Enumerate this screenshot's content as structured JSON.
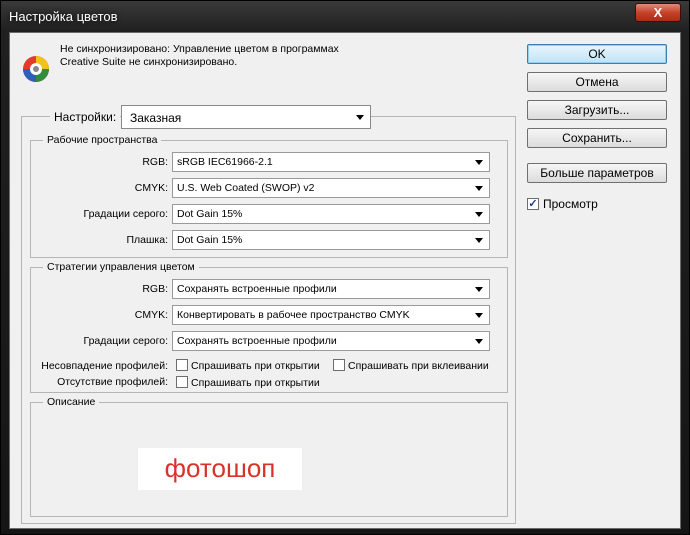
{
  "window": {
    "title": "Настройка цветов",
    "close_label": "X"
  },
  "message": {
    "line1": "Не синхронизировано: Управление цветом в программах",
    "line2": "Creative Suite не синхронизировано."
  },
  "settings": {
    "label": "Настройки:",
    "value": "Заказная"
  },
  "working_spaces": {
    "title": "Рабочие пространства",
    "rows": [
      {
        "label": "RGB:",
        "value": "sRGB IEC61966-2.1"
      },
      {
        "label": "CMYK:",
        "value": "U.S. Web Coated (SWOP) v2"
      },
      {
        "label": "Градации серого:",
        "value": "Dot Gain 15%"
      },
      {
        "label": "Плашка:",
        "value": "Dot Gain 15%"
      }
    ]
  },
  "policies": {
    "title": "Стратегии управления цветом",
    "rows": [
      {
        "label": "RGB:",
        "value": "Сохранять встроенные профили"
      },
      {
        "label": "CMYK:",
        "value": "Конвертировать в рабочее пространство CMYK"
      },
      {
        "label": "Градации серого:",
        "value": "Сохранять встроенные профили"
      }
    ],
    "mismatch_label": "Несовпадение профилей:",
    "mismatch_open": "Спрашивать при открытии",
    "mismatch_paste": "Спрашивать при вклеивании",
    "missing_label": "Отсутствие профилей:",
    "missing_open": "Спрашивать при открытии"
  },
  "description": {
    "title": "Описание"
  },
  "buttons": {
    "ok": "OK",
    "cancel": "Отмена",
    "load": "Загрузить...",
    "save": "Сохранить...",
    "more": "Больше параметров"
  },
  "preview": {
    "label": "Просмотр",
    "checked": true
  },
  "watermark": {
    "text": "фотошоп"
  },
  "colors": {
    "accent": "#3c7fb1",
    "watermark": "#d9322a"
  }
}
